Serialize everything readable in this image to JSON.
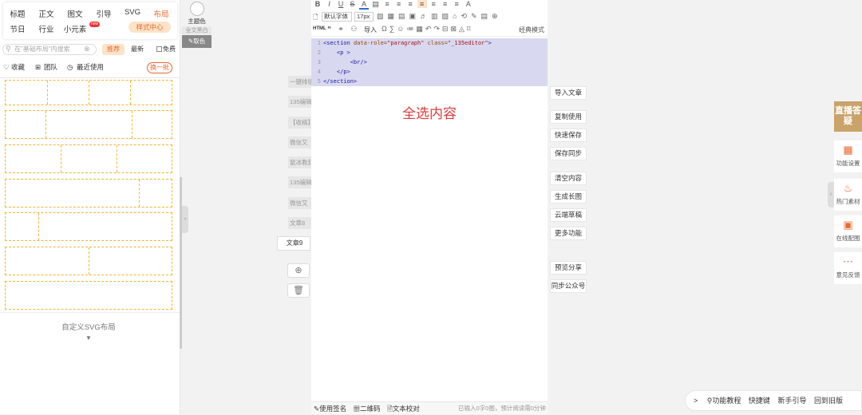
{
  "nav": {
    "row1": [
      "标题",
      "正文",
      "图文",
      "引导",
      "SVG",
      "布局"
    ],
    "row2": [
      "节日",
      "行业",
      "小元素"
    ],
    "new_badge": "new",
    "style_center": "样式中心"
  },
  "search": {
    "placeholder": "在\"基础布局\"内搜索",
    "recommend": "推荐",
    "latest": "最新",
    "free": "免费"
  },
  "filters": {
    "favorites": "收藏",
    "team": "团队",
    "recent": "最近使用",
    "refresh": "换一批"
  },
  "svg_layout": {
    "label": "自定义SVG布局",
    "arrow": "▼"
  },
  "color_panel": {
    "theme": "主题色",
    "all_black_white": "全文黑白",
    "pick_color": "取色"
  },
  "history": {
    "items": [
      "一键排版",
      "135编辑",
      "【收稿】",
      "微信又",
      "鼠冰教封",
      "135编辑",
      "微信又",
      "文章8"
    ],
    "active": "文章9"
  },
  "toolbar": {
    "row1": [
      "B",
      "I",
      "U",
      "S",
      "A",
      "▤",
      "≡",
      "≡",
      "≡",
      "≡",
      "≡",
      "≡",
      "≡",
      "A"
    ],
    "font_family": "默认字体",
    "font_size": "17px",
    "html_label": "HTML",
    "import_label": "导入",
    "classic_mode": "经典模式"
  },
  "code": [
    {
      "n": "1",
      "parts": [
        [
          "tag",
          "<section"
        ],
        [
          "txt",
          " "
        ],
        [
          "attr",
          "data-role="
        ],
        [
          "str",
          "\"paragraph\""
        ],
        [
          "txt",
          " "
        ],
        [
          "attr",
          "class="
        ],
        [
          "str",
          "\"_135editor\""
        ],
        [
          "tag",
          ">"
        ]
      ]
    },
    {
      "n": "2",
      "parts": [
        [
          "txt",
          "    "
        ],
        [
          "tag",
          "<p >"
        ]
      ]
    },
    {
      "n": "3",
      "parts": [
        [
          "txt",
          "        "
        ],
        [
          "tag",
          "<br/>"
        ]
      ]
    },
    {
      "n": "4",
      "parts": [
        [
          "txt",
          "    "
        ],
        [
          "tag",
          "</p>"
        ]
      ]
    },
    {
      "n": "5",
      "parts": [
        [
          "tag",
          "</section>"
        ]
      ]
    }
  ],
  "select_all_text": "全选内容",
  "statusbar": {
    "signature": "使用签名",
    "qrcode": "二维码",
    "proofread": "文本校对",
    "stats": "已输入0字0图，预计阅读需0分钟"
  },
  "right_actions": [
    "导入文章",
    "复制使用",
    "快速保存",
    "保存同步",
    "清空内容",
    "生成长图",
    "云端草稿",
    "更多功能",
    "预览分享",
    "同步公众号"
  ],
  "right_sidebar": {
    "live": "直播答疑",
    "items": [
      {
        "label": "功能设置",
        "icon": "▦"
      },
      {
        "label": "热门素材",
        "icon": "♨"
      },
      {
        "label": "在线配图",
        "icon": "▣"
      },
      {
        "label": "意见反馈",
        "icon": "⋯"
      }
    ]
  },
  "bottom_bar": {
    "toggle": ">",
    "tutorial": "功能教程",
    "shortcuts": "快捷键",
    "guide": "新手引导",
    "old_version": "回到旧版"
  },
  "colors": {
    "accent": "#e8692e",
    "dashed": "#f2b632",
    "select_bg": "#d8d8f0",
    "red_text": "#e23a3a"
  }
}
